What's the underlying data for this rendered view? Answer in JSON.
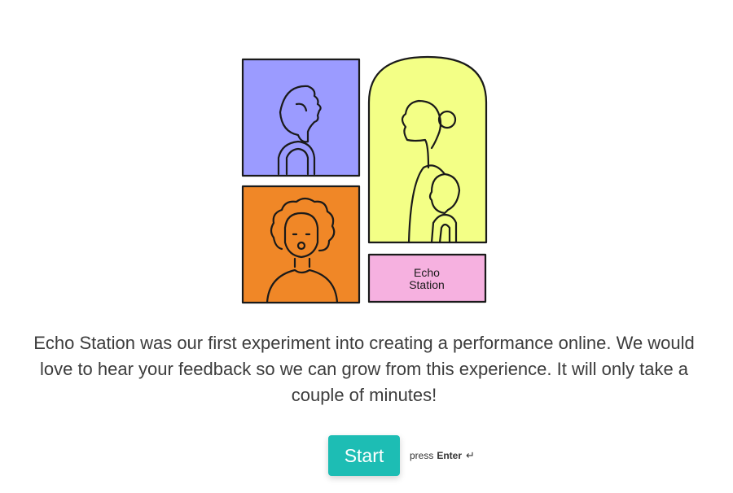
{
  "illustration": {
    "logo_line1": "Echo",
    "logo_line2": "Station",
    "colors": {
      "purple": "#9b9bff",
      "orange": "#f08727",
      "yellow": "#f3ff86",
      "pink": "#f6b1e0",
      "stroke": "#1a1a1a"
    }
  },
  "intro": {
    "text": "Echo Station was our first experiment into creating a performance online. We would love to hear your feedback so we can grow from this experience. It will only take a couple of minutes!"
  },
  "cta": {
    "start_label": "Start",
    "hint_prefix": "press",
    "hint_key": "Enter",
    "enter_glyph": "↵"
  }
}
